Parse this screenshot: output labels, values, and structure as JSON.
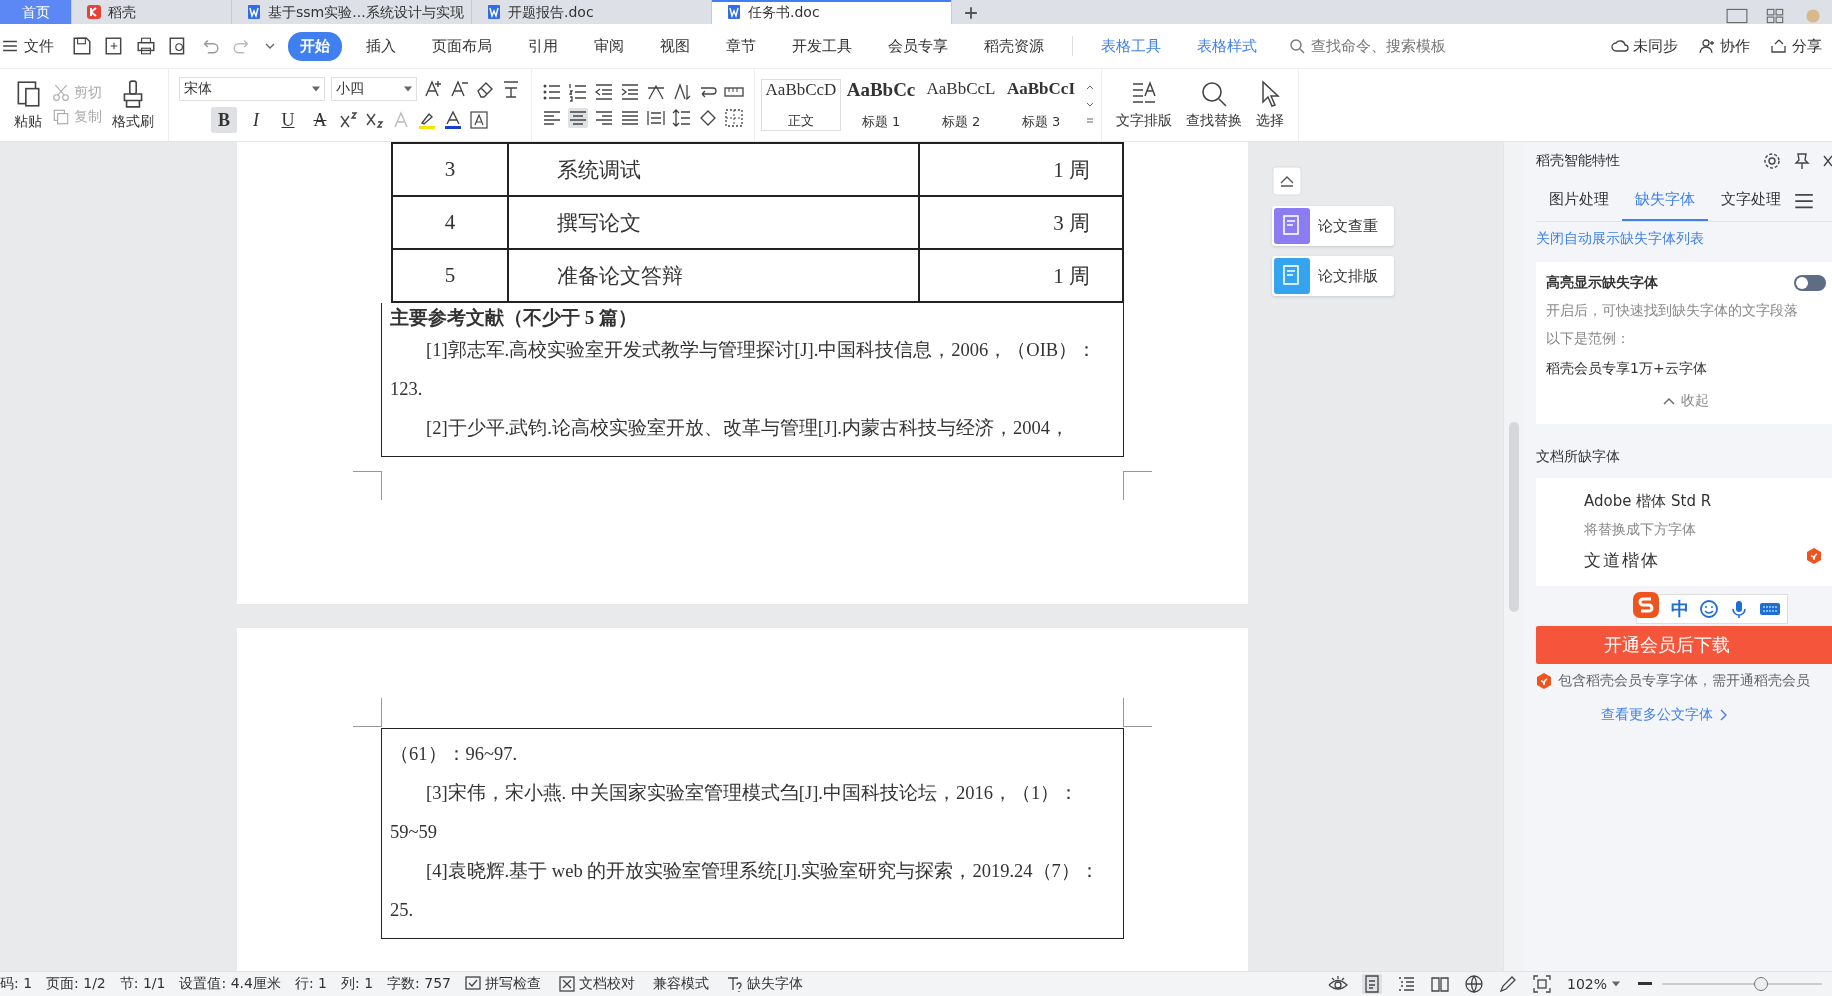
{
  "title_tabs": [
    {
      "label": "首页",
      "kind": "home",
      "selected": false
    },
    {
      "label": "稻壳",
      "kind": "app",
      "selected": false
    },
    {
      "label": "基于ssm实验...系统设计与实现",
      "kind": "doc",
      "selected": false
    },
    {
      "label": "开题报告.doc",
      "kind": "doc",
      "selected": false
    },
    {
      "label": "任务书.doc",
      "kind": "doc",
      "selected": true
    }
  ],
  "menu": {
    "file": "文件",
    "tabs": [
      {
        "label": "开始",
        "selected": true
      },
      {
        "label": "插入",
        "selected": false
      },
      {
        "label": "页面布局",
        "selected": false
      },
      {
        "label": "引用",
        "selected": false
      },
      {
        "label": "审阅",
        "selected": false
      },
      {
        "label": "视图",
        "selected": false
      },
      {
        "label": "章节",
        "selected": false
      },
      {
        "label": "开发工具",
        "selected": false
      },
      {
        "label": "会员专享",
        "selected": false
      },
      {
        "label": "稻壳资源",
        "selected": false
      }
    ],
    "context_tabs": [
      "表格工具",
      "表格样式"
    ],
    "search_placeholder": "查找命令、搜索模板",
    "actions": [
      {
        "label": "未同步",
        "kind": "cloud"
      },
      {
        "label": "协作",
        "kind": "person"
      },
      {
        "label": "分享",
        "kind": "share"
      }
    ]
  },
  "ribbon": {
    "paste": "粘贴",
    "cut": "剪切",
    "copy": "复制",
    "format_painter": "格式刷",
    "font": "宋体",
    "size": "小四",
    "format_buttons": [
      {
        "glyph": "B",
        "kind": "bold",
        "selected": true
      },
      {
        "glyph": "I",
        "kind": "italic",
        "selected": false
      },
      {
        "glyph": "U",
        "kind": "underline",
        "selected": false
      },
      {
        "glyph": "A",
        "kind": "strike",
        "selected": false
      }
    ],
    "align_buttons": [
      {
        "kind": "left",
        "selected": false
      },
      {
        "kind": "center",
        "selected": true
      },
      {
        "kind": "right",
        "selected": false
      },
      {
        "kind": "justify",
        "selected": false
      },
      {
        "kind": "distribute",
        "selected": false
      }
    ],
    "styles": [
      {
        "preview": "AaBbCcD",
        "label": "正文",
        "kind": "normal"
      },
      {
        "preview": "AaBbCc",
        "label": "标题 1",
        "kind": "h1"
      },
      {
        "preview": "AaBbCcL",
        "label": "标题 2",
        "kind": "h2"
      },
      {
        "preview": "AaBbCcI",
        "label": "标题 3",
        "kind": "h3"
      }
    ],
    "text_layout": "文字排版",
    "find_replace": "查找替换",
    "select": "选择"
  },
  "document": {
    "schedule_rows": [
      {
        "no": "3",
        "task": "系统调试",
        "duration": "1 周"
      },
      {
        "no": "4",
        "task": "撰写论文",
        "duration": "3 周"
      },
      {
        "no": "5",
        "task": "准备论文答辩",
        "duration": "1 周"
      }
    ],
    "references_heading": "主要参考文献（不少于 5 篇）",
    "page1_lines": [
      {
        "text": "[1]郭志军.高校实验室开发式教学与管理探讨[J].中国科技信息，2006，（OIB）：",
        "indent": true
      },
      {
        "text": "123.",
        "indent": false
      },
      {
        "text": "[2]于少平.武钧.论高校实验室开放、改革与管理[J].内蒙古科技与经济，2004，",
        "indent": true
      }
    ],
    "page2_lines": [
      {
        "text": "（61）：96~97.",
        "indent": false
      },
      {
        "text": "[3]宋伟，宋小燕. 中关国家实验室管理模式刍[J].中国科技论坛，2016，（1）：",
        "indent": true
      },
      {
        "text": "59~59",
        "indent": false
      },
      {
        "text": "[4]袁晓辉.基于 web 的开放实验室管理系统[J].实验室研究与探索，2019.24（7）：",
        "indent": true
      },
      {
        "text": "25.",
        "indent": false
      }
    ]
  },
  "floating_buttons": [
    "论文查重",
    "论文排版"
  ],
  "side_panel": {
    "title": "稻壳智能特性",
    "tabs": [
      {
        "label": "图片处理",
        "selected": false
      },
      {
        "label": "缺失字体",
        "selected": true
      },
      {
        "label": "文字处理",
        "selected": false
      }
    ],
    "close_link": "关闭自动展示缺失字体列表",
    "highlight": {
      "title": "高亮显示缺失字体",
      "on": false,
      "description": "开启后，可快速找到缺失字体的文字段落",
      "example_label": "以下是范例：",
      "example": "稻壳会员专享1万+云字体",
      "collapse": "收起"
    },
    "missing_heading": "文档所缺字体",
    "missing_font": {
      "name": "Adobe 楷体 Std R",
      "replace_note": "将替换成下方字体",
      "replacement": "文道楷体"
    },
    "download_button": "开通会员后下载",
    "member_note": "包含稻壳会员专享字体，需开通稻壳会员",
    "more_link": "查看更多公文字体"
  },
  "ime_bar": {
    "mode": "中"
  },
  "status_bar": {
    "items": [
      "码: 1",
      "页面: 1/2",
      "节: 1/1",
      "设置值: 4.4厘米",
      "行: 1",
      "列: 1",
      "字数: 757"
    ],
    "tools": [
      {
        "label": "拼写检查",
        "kind": "spell"
      },
      {
        "label": "文档校对",
        "kind": "proof"
      },
      {
        "label": "兼容模式",
        "kind": "plain"
      },
      {
        "label": "缺失字体",
        "kind": "font"
      }
    ],
    "views": [
      {
        "kind": "eye",
        "selected": false
      },
      {
        "kind": "page",
        "selected": true
      },
      {
        "kind": "outline",
        "selected": false
      },
      {
        "kind": "read",
        "selected": false
      },
      {
        "kind": "web",
        "selected": false
      },
      {
        "kind": "pen",
        "selected": false
      }
    ],
    "zoom": "102%",
    "zoom_slider": {
      "level": 0.62
    }
  }
}
